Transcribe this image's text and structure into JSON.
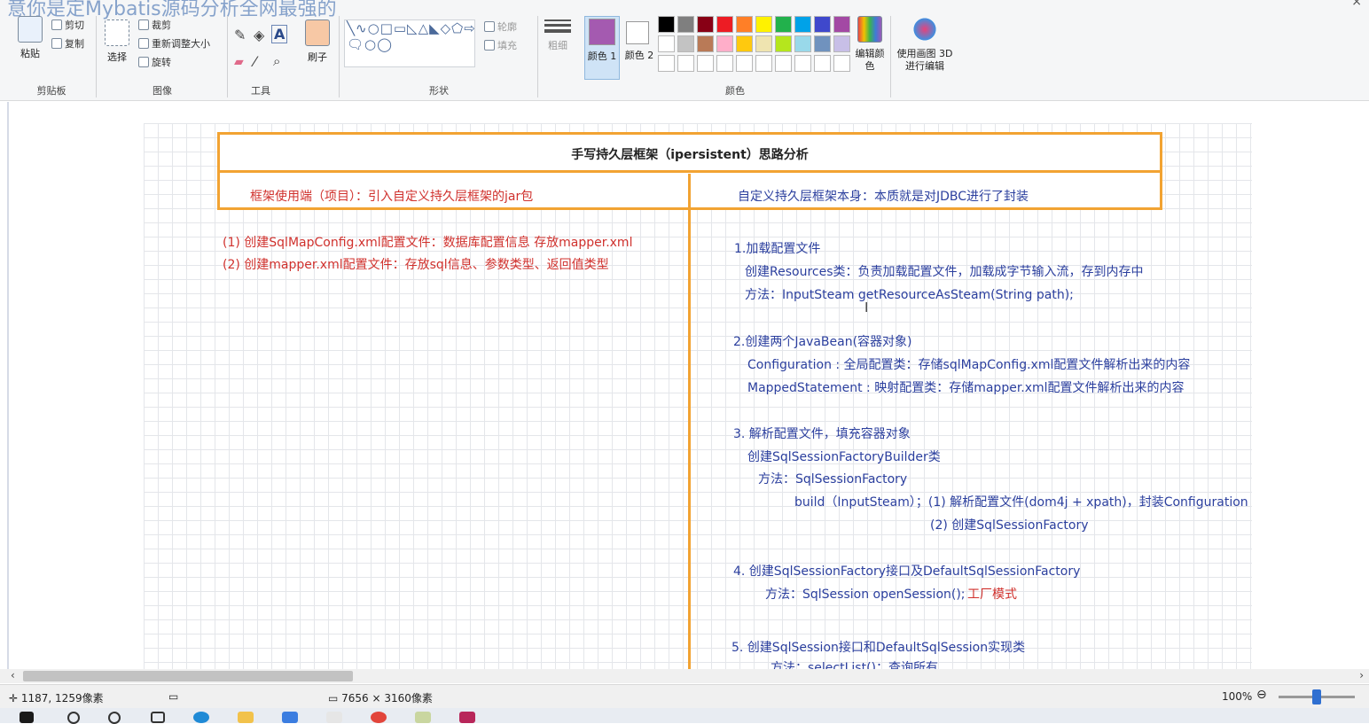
{
  "window": {
    "title_fragment": "意你是定Mybatis源码分析全网最强的",
    "close_glyph": "×"
  },
  "ribbon": {
    "clipboard": {
      "paste": "粘贴",
      "cut": "剪切",
      "copy": "复制",
      "label": "剪贴板"
    },
    "image": {
      "select": "选择",
      "crop": "裁剪",
      "resize": "重新调整大小",
      "rotate": "旋转",
      "label": "图像"
    },
    "tools": {
      "label": "工具"
    },
    "brushes": {
      "label": "刷子"
    },
    "shapes": {
      "outline": "轮廓",
      "fill": "填充",
      "label": "形状",
      "glyphs": "╲∿○□▭◺△◣◇⬠⇨⇦⇧⇩✧☆✩🗨○◯"
    },
    "size": {
      "label": "粗细"
    },
    "colors": {
      "color1": "颜色 1",
      "color2": "颜色 2",
      "edit": "编辑颜色",
      "paint3d": "使用画图 3D 进行编辑",
      "label": "颜色",
      "current1": "#a45ab0",
      "current2": "#ffffff",
      "row1": [
        "#000000",
        "#7f7f7f",
        "#880015",
        "#ed1c24",
        "#ff7f27",
        "#fff200",
        "#22b14c",
        "#00a2e8",
        "#3f48cc",
        "#a349a4"
      ],
      "row2": [
        "#ffffff",
        "#c3c3c3",
        "#b97a57",
        "#ffaec9",
        "#ffc90e",
        "#efe4b0",
        "#b5e61d",
        "#99d9ea",
        "#7092be",
        "#c8bfe7"
      ]
    }
  },
  "canvas": {
    "title": "手写持久层框架（ipersistent）思路分析",
    "left_header": "框架使用端（项目）：引入自定义持久层框架的jar包",
    "right_header": "自定义持久层框架本身：本质就是对JDBC进行了封装",
    "left_lines": [
      "(1) 创建SqlMapConfig.xml配置文件：数据库配置信息   存放mapper.xml",
      "(2) 创建mapper.xml配置文件：存放sql信息、参数类型、返回值类型"
    ],
    "right_lines": {
      "s1": "1.加载配置文件",
      "s1a": "创建Resources类：负责加载配置文件，加载成字节输入流，存到内存中",
      "s1b": "方法：InputSteam getResourceAsSteam(String path);",
      "s2": "2.创建两个JavaBean(容器对象)",
      "s2a": "Configuration : 全局配置类：存储sqlMapConfig.xml配置文件解析出来的内容",
      "s2b": "MappedStatement : 映射配置类：存储mapper.xml配置文件解析出来的内容",
      "s3": "3. 解析配置文件，填充容器对象",
      "s3a": "创建SqlSessionFactoryBuilder类",
      "s3b": "方法：SqlSessionFactory",
      "s3c": "build（InputSteam）；(1) 解析配置文件(dom4j + xpath)，封装Configuration",
      "s3d": "(2) 创建SqlSessionFactory",
      "s4": "4. 创建SqlSessionFactory接口及DefaultSqlSessionFactory",
      "s4a": "方法：SqlSession  openSession();",
      "s4b": "工厂模式",
      "s5": "5. 创建SqlSession接口和DefaultSqlSession实现类",
      "s5a": "方法：selectList()：查询所有"
    },
    "text_cursor": "I"
  },
  "status": {
    "position": "1187, 1259像素",
    "dimensions": "7656 × 3160像素",
    "zoom": "100%",
    "zoom_out": "⊖",
    "zoom_level": 0.5
  }
}
